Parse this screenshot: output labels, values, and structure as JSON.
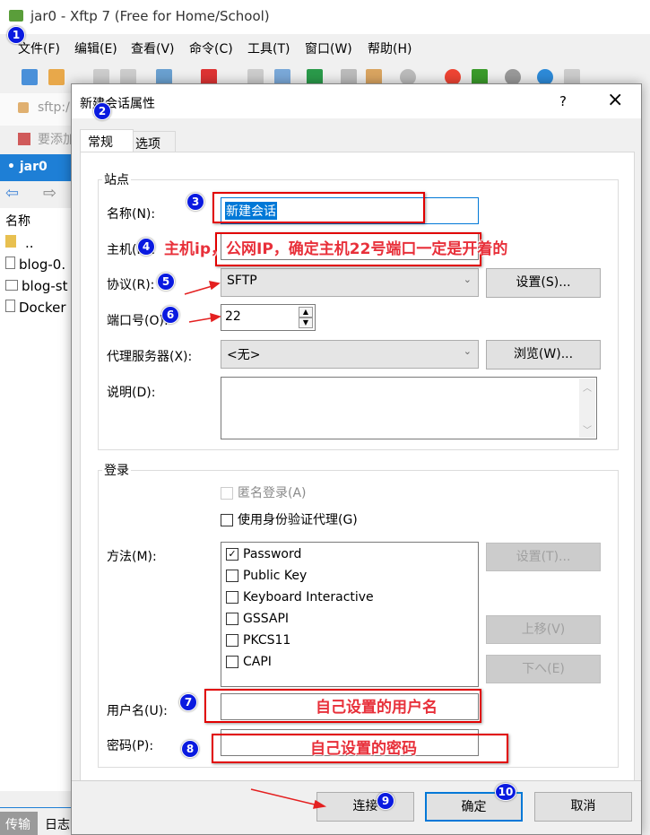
{
  "window": {
    "title": "jar0 - Xftp 7 (Free for Home/School)"
  },
  "menu": [
    "文件(F)",
    "编辑(E)",
    "查看(V)",
    "命令(C)",
    "工具(T)",
    "窗口(W)",
    "帮助(H)"
  ],
  "address": {
    "value": "sftp:/",
    "hint": "要添加"
  },
  "session_tab": "jar0",
  "file_panel": {
    "header": "名称",
    "files": [
      "..",
      "blog-0.",
      "blog-st",
      "Docker"
    ]
  },
  "bottom_tabs": [
    "传输",
    "日志"
  ],
  "dialog": {
    "title": "新建会话属性",
    "help": "?",
    "close": "×",
    "tabs": [
      "常规",
      "选项"
    ],
    "site": {
      "group_label": "站点",
      "name_label": "名称(N):",
      "name_value": "新建会话",
      "host_label": "主机(H):",
      "host_value": "",
      "protocol_label": "协议(R):",
      "protocol_value": "SFTP",
      "protocol_settings": "设置(S)...",
      "port_label": "端口号(O):",
      "port_value": "22",
      "proxy_label": "代理服务器(X):",
      "proxy_value": "<无>",
      "proxy_browse": "浏览(W)...",
      "desc_label": "说明(D):",
      "desc_value": ""
    },
    "login": {
      "group_label": "登录",
      "anonymous": "匿名登录(A)",
      "agent": "使用身份验证代理(G)",
      "method_label": "方法(M):",
      "methods": [
        {
          "label": "Password",
          "checked": true
        },
        {
          "label": "Public Key",
          "checked": false
        },
        {
          "label": "Keyboard Interactive",
          "checked": false
        },
        {
          "label": "GSSAPI",
          "checked": false
        },
        {
          "label": "PKCS11",
          "checked": false
        },
        {
          "label": "CAPI",
          "checked": false
        }
      ],
      "method_settings": "设置(T)...",
      "move_up": "上移(V)",
      "move_down": "下へ(E)",
      "user_label": "用户名(U):",
      "user_value": "",
      "pass_label": "密码(P):",
      "pass_value": ""
    },
    "buttons": {
      "connect": "连接",
      "ok": "确定",
      "cancel": "取消"
    }
  },
  "annotations": {
    "host_note": "主机ip，公网IP，确定主机22号端口一定是开着的",
    "user_note": "自己设置的用户名",
    "pass_note": "自己设置的密码",
    "badges": [
      "1",
      "2",
      "3",
      "4",
      "5",
      "6",
      "7",
      "8",
      "9",
      "10"
    ]
  }
}
